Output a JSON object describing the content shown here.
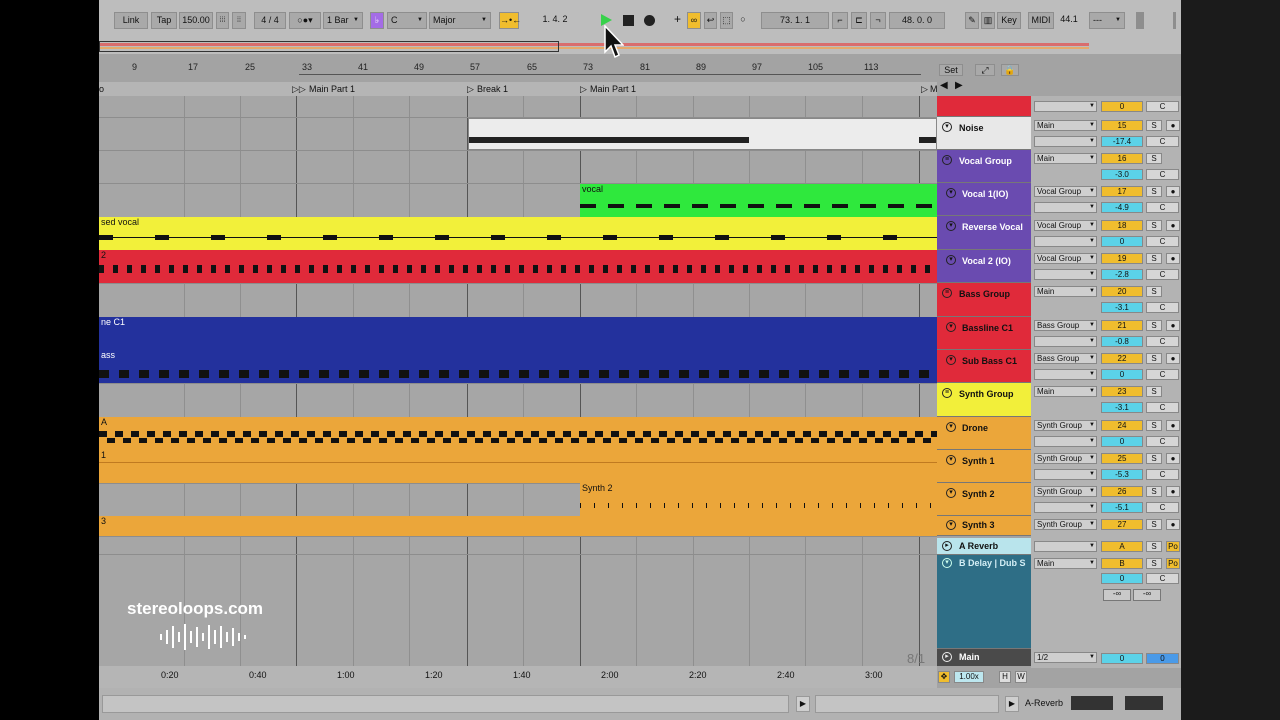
{
  "transport": {
    "link": "Link",
    "tap": "Tap",
    "tempo": "150.00",
    "sig_num": "4",
    "sig_den": "4",
    "quantize": "1 Bar",
    "scale_root": "C",
    "scale_mode": "Major",
    "arr_position": "1.   4.   2",
    "loop_start": "73.   1.   1",
    "loop_length": "48.   0.   0",
    "key": "Key",
    "midi": "MIDI",
    "cpu": "44.1",
    "extra": "---"
  },
  "ruler": [
    "9",
    "17",
    "25",
    "33",
    "41",
    "49",
    "57",
    "65",
    "73",
    "81",
    "89",
    "97",
    "105",
    "113"
  ],
  "locators": {
    "start": "o",
    "main1": "Main Part 1",
    "break1": "Break 1",
    "main2": "Main Part 1",
    "end": "M"
  },
  "clips": {
    "vocal": "vocal",
    "reversed": "sed vocal",
    "vocal2": "2",
    "bassline": "ne C1",
    "subbass": "ass",
    "drone": "A",
    "synth1": "1",
    "synth2": "Synth 2",
    "synth3": "3"
  },
  "set_button": "Set",
  "tracks": [
    {
      "name": "Noise",
      "route": "Main",
      "num": "15",
      "vol": "-17.4"
    },
    {
      "name": "Vocal Group",
      "route": "Main",
      "num": "16",
      "vol": "-3.0"
    },
    {
      "name": "Vocal 1(IO)",
      "route": "Vocal Group",
      "num": "17",
      "vol": "-4.9"
    },
    {
      "name": "Reverse Vocal",
      "route": "Vocal Group",
      "num": "18",
      "vol": "0"
    },
    {
      "name": "Vocal 2 (IO)",
      "route": "Vocal Group",
      "num": "19",
      "vol": "-2.8"
    },
    {
      "name": "Bass Group",
      "route": "Main",
      "num": "20",
      "vol": "-3.1"
    },
    {
      "name": "Bassline C1",
      "route": "Bass Group",
      "num": "21",
      "vol": "-0.8"
    },
    {
      "name": "Sub Bass C1",
      "route": "Bass Group",
      "num": "22",
      "vol": "0"
    },
    {
      "name": "Synth Group",
      "route": "Main",
      "num": "23",
      "vol": "-3.1"
    },
    {
      "name": "Drone",
      "route": "Synth Group",
      "num": "24",
      "vol": "0"
    },
    {
      "name": "Synth 1",
      "route": "Synth Group",
      "num": "25",
      "vol": "-5.3"
    },
    {
      "name": "Synth 2",
      "route": "Synth Group",
      "num": "26",
      "vol": "-5.1"
    },
    {
      "name": "Synth 3",
      "route": "Synth Group",
      "num": "27",
      "vol": ""
    }
  ],
  "top_track": {
    "num": "0"
  },
  "returns": [
    {
      "name": "A Reverb",
      "num": "A",
      "post": "Po"
    },
    {
      "name": "B Delay | Dub S",
      "route": "Main",
      "num": "B",
      "post": "Po",
      "vol": "0",
      "send1": "-∞",
      "send2": "-∞"
    }
  ],
  "main": {
    "name": "Main",
    "route": "1/2",
    "a": "0",
    "b": "0"
  },
  "labels": {
    "solo": "S",
    "c": "C"
  },
  "time_ticks": [
    "0:20",
    "0:40",
    "1:00",
    "1:20",
    "1:40",
    "2:00",
    "2:20",
    "2:40",
    "3:00"
  ],
  "page_indicator": "8/1",
  "zoom": "1.00x",
  "h_btn": "H",
  "w_btn": "W",
  "bottom_device": "A-Reverb",
  "watermark": "stereoloops.com",
  "colors": {
    "noise": "#e8e8e8",
    "vocal_group": "#6a4bb0",
    "vocal1": "#2fe83d",
    "reverse": "#f2f03a",
    "red": "#e02a3a",
    "blue": "#23319d",
    "yellow": "#f2ef3a",
    "orange": "#eba63a",
    "return_a": "#b9e4ec",
    "return_b": "#2e6e86"
  }
}
